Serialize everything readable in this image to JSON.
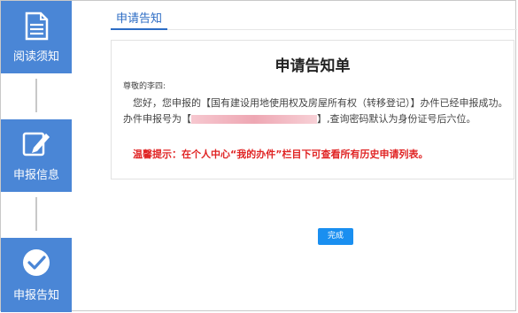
{
  "steps": [
    {
      "label": "阅读须知",
      "icon": "document-icon"
    },
    {
      "label": "申报信息",
      "icon": "edit-icon"
    },
    {
      "label": "申报告知",
      "icon": "check-circle-icon"
    }
  ],
  "tab": {
    "label": "申请告知"
  },
  "notice": {
    "title": "申请告知单",
    "greeting": "尊敬的李四:",
    "line1_prefix": "您好，您申报的",
    "line1_item": "【国有建设用地使用权及房屋所有权（转移登记）】",
    "line1_suffix": "办件已经申报成功。",
    "line2_prefix": "办件申报号为【",
    "line2_suffix": "】,查询密码默认为身份证号后六位。",
    "tip": "温馨提示：在个人中心“我的办件”栏目下可查看所有历史申请列表。"
  },
  "actions": {
    "finish": "完成"
  },
  "colors": {
    "rail": "#4a86d6",
    "tab": "#2c6cc4",
    "tip": "#e02424",
    "button": "#1a8ff0"
  }
}
